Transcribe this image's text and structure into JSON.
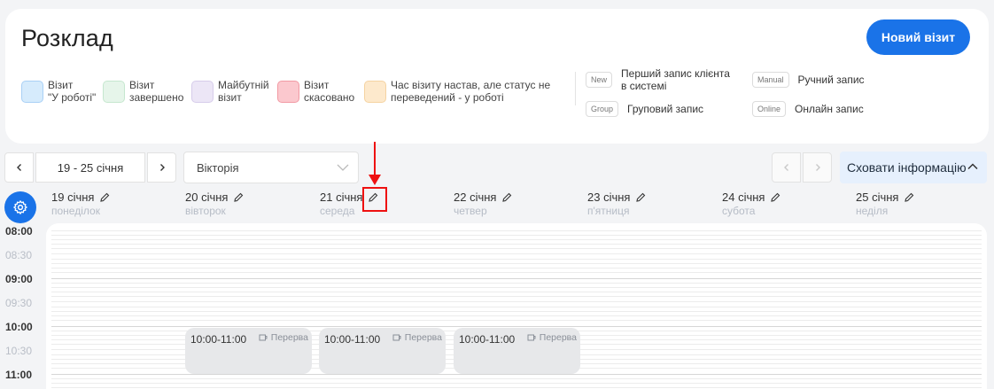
{
  "page": {
    "title": "Розклад",
    "new_visit_button": "Новий візит"
  },
  "legend": [
    {
      "label": "Візит\n\"У роботі\"",
      "color": "#d6ebfc",
      "border": "#a9d0f5"
    },
    {
      "label": "Візит\nзавершено",
      "color": "#e6f5ea",
      "border": "#c6e7cf"
    },
    {
      "label": "Майбутній\nвізит",
      "color": "#ece6f6",
      "border": "#d6ccea"
    },
    {
      "label": "Візит\nскасовано",
      "color": "#fbc8ce",
      "border": "#f29aa4"
    },
    {
      "label": "Час візиту настав, але статус не\nпереведений - у роботі",
      "color": "#fde9cc",
      "border": "#f5d3a2"
    }
  ],
  "tags": [
    {
      "badge": "New",
      "label": "Перший запис клієнта\nв системі"
    },
    {
      "badge": "Group",
      "label": "Груповий запис"
    },
    {
      "badge": "Manual",
      "label": "Ручний запис"
    },
    {
      "badge": "Online",
      "label": "Онлайн запис"
    }
  ],
  "toolbar": {
    "prev_week": "‹",
    "next_week": "›",
    "week_range": "19 - 25 січня",
    "staff_select": "Вікторія",
    "hide_info": "Сховати інформацію"
  },
  "days": [
    {
      "date": "19 січня",
      "name": "понеділок"
    },
    {
      "date": "20 січня",
      "name": "вівторок"
    },
    {
      "date": "21 січня",
      "name": "середа"
    },
    {
      "date": "22 січня",
      "name": "четвер"
    },
    {
      "date": "23 січня",
      "name": "п'ятниця"
    },
    {
      "date": "24 січня",
      "name": "субота"
    },
    {
      "date": "25 січня",
      "name": "неділя"
    }
  ],
  "times": [
    "08:00",
    "08:30",
    "09:00",
    "09:30",
    "10:00",
    "10:30",
    "11:00"
  ],
  "breaks": [
    {
      "time": "10:00-11:00",
      "label": "Перерва"
    },
    {
      "time": "10:00-11:00",
      "label": "Перерва"
    },
    {
      "time": "10:00-11:00",
      "label": "Перерва"
    }
  ],
  "colors": {
    "accent": "#1a73e8",
    "highlight": "#e11111"
  }
}
